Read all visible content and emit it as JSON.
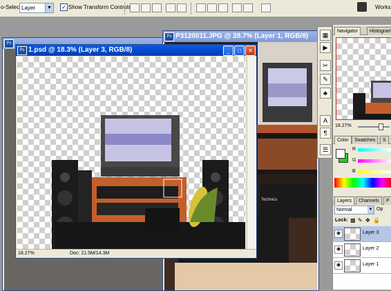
{
  "options_bar": {
    "auto_select_label": "o-Select:",
    "layer_select_value": "Layer",
    "show_transform_label": "Show Transform Controls",
    "workspace_label": "Worksp"
  },
  "windows": {
    "back_left_title": "...",
    "back_right_title": "P3120011.JPG @ 28.7% (Layer 1, RGB/8)",
    "front_title": "1.psd @ 18.3% (Layer 3, RGB/8)",
    "front_zoom": "18.27%",
    "front_doc": "Doc: 21.5M/14.3M"
  },
  "photo": {
    "brand_label": "Technics"
  },
  "navigator": {
    "tab_navigator": "Navigator",
    "tab_histogram": "Histogram",
    "zoom": "18.27%"
  },
  "color": {
    "tab_color": "Color",
    "tab_swatches": "Swatches",
    "tab_styles": "S",
    "r_label": "R",
    "g_label": "G",
    "b_label": "B",
    "foreground": "#ffffff",
    "background": "#22cc22"
  },
  "layers": {
    "tab_layers": "Layers",
    "tab_channels": "Channels",
    "tab_paths": "P",
    "blend_mode": "Normal",
    "opacity_label": "Op",
    "lock_label": "Lock:",
    "items": [
      {
        "name": "Layer 3",
        "selected": true
      },
      {
        "name": "Layer 2",
        "selected": false
      },
      {
        "name": "Layer 1",
        "selected": false
      }
    ]
  },
  "colors": {
    "titlebar_active": "#0249c9",
    "close_red": "#c03a1e",
    "panel_bg": "#ece9d8"
  }
}
